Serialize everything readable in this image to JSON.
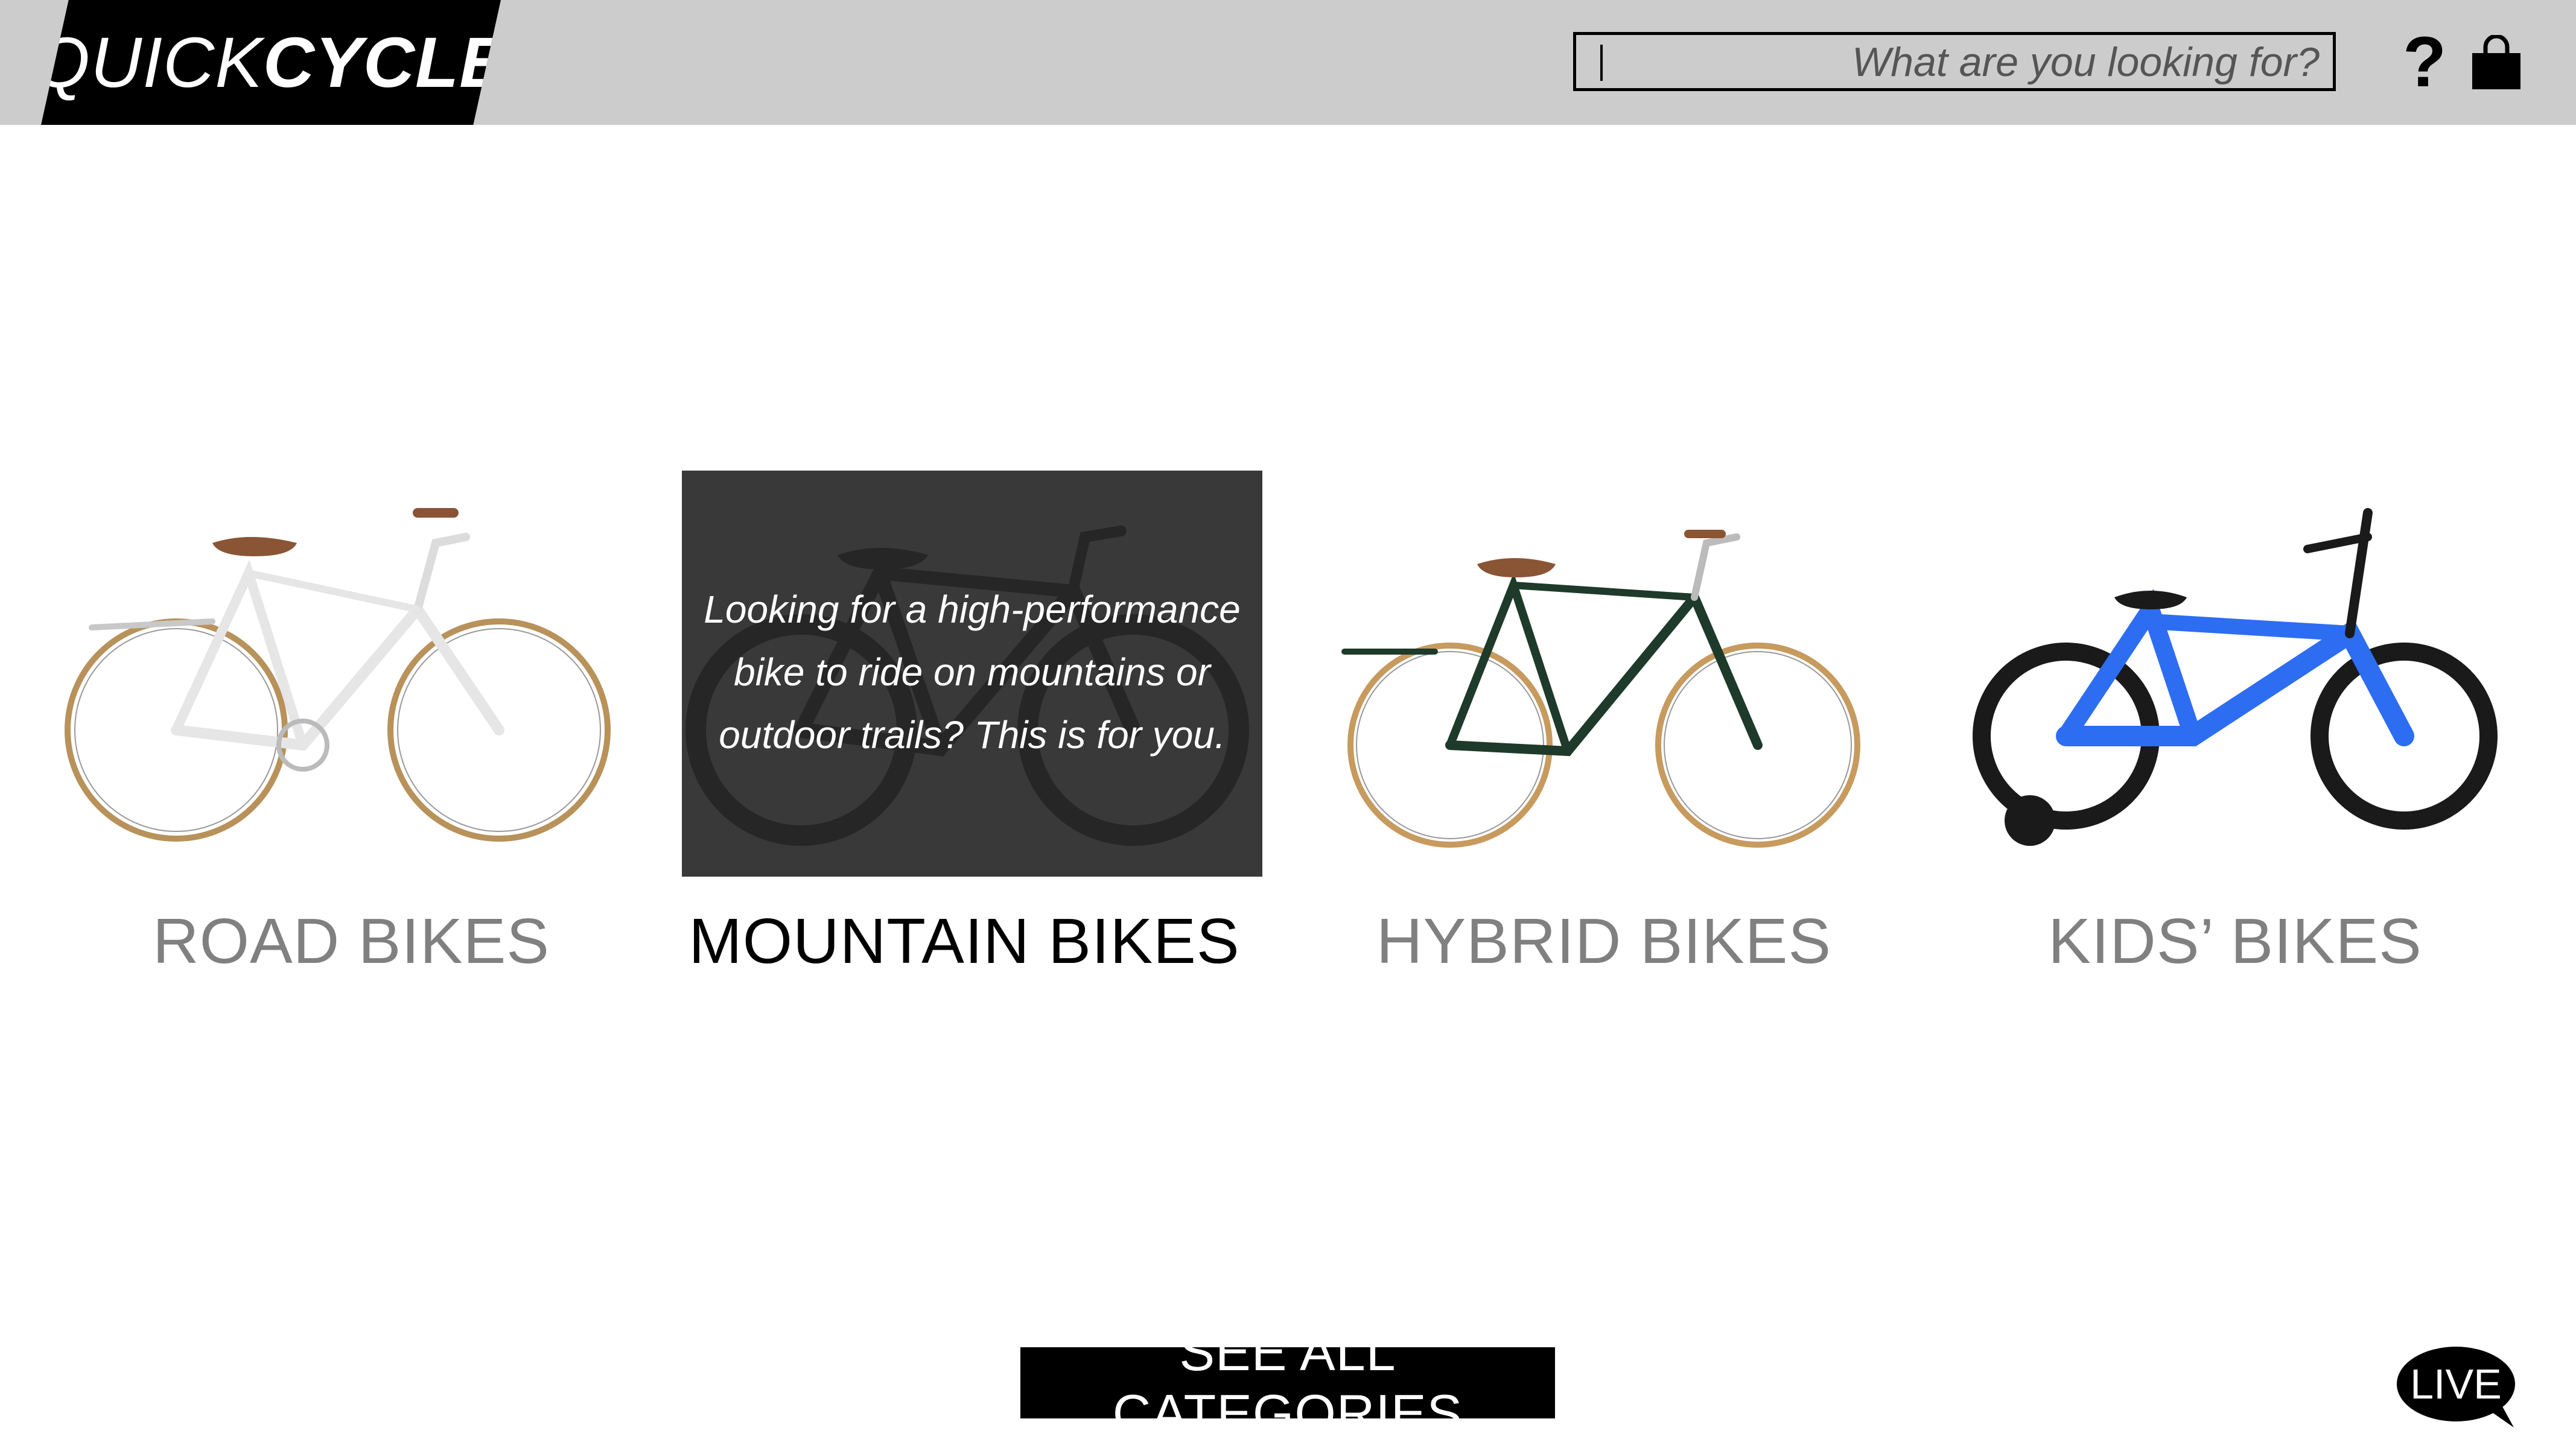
{
  "header": {
    "logo_light": "QUICK",
    "logo_bold": "CYCLE",
    "search": {
      "placeholder": "What are you looking for?",
      "value": ""
    }
  },
  "icons": {
    "help": "?",
    "cart": "shopping-bag-icon"
  },
  "categories": [
    {
      "label": "ROAD BIKES",
      "active": false,
      "bike_color": "#f2f2f2"
    },
    {
      "label": "MOUNTAIN BIKES",
      "active": true,
      "bike_color": "#111111",
      "overlay_lines": [
        "Looking for a high-performance",
        "bike to ride on mountains or",
        "outdoor trails? This is for you."
      ]
    },
    {
      "label": "HYBRID BIKES",
      "active": false,
      "bike_color": "#1e3a2a"
    },
    {
      "label": "KIDS’ BIKES",
      "active": false,
      "bike_color": "#2d6df2"
    }
  ],
  "footer": {
    "see_all_label": "SEE ALL CATEGORIES",
    "live_label": "LIVE"
  },
  "colors": {
    "header_bg": "#cccccc",
    "logo_bg": "#000000",
    "inactive_label": "#808080",
    "active_label": "#000000",
    "overlay": "#333333"
  }
}
